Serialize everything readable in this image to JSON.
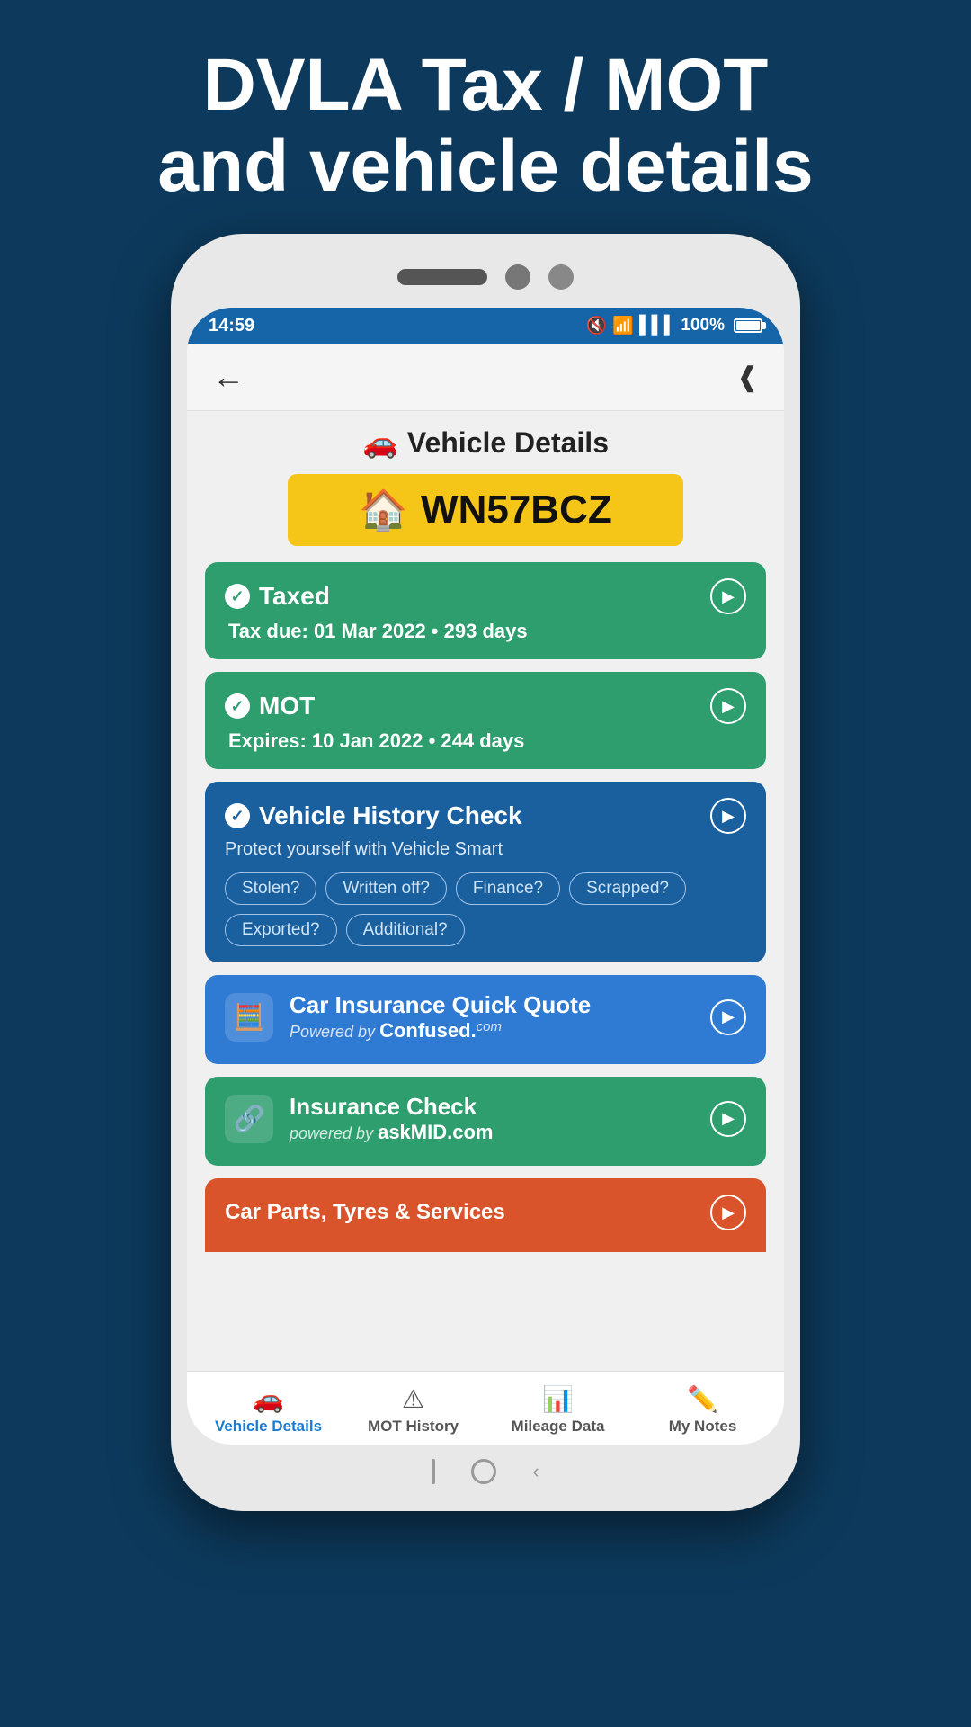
{
  "header": {
    "title_line1": "DVLA Tax / MOT",
    "title_line2": "and vehicle details"
  },
  "status_bar": {
    "time": "14:59",
    "battery": "100%"
  },
  "nav": {
    "back_label": "‹",
    "share_label": "⋘"
  },
  "page_title": "Vehicle Details",
  "license_plate": "WN57BCZ",
  "cards": {
    "taxed": {
      "title": "Taxed",
      "subtitle": "Tax due: 01 Mar 2022 • 293 days"
    },
    "mot": {
      "title": "MOT",
      "subtitle": "Expires: 10 Jan 2022 • 244 days"
    },
    "vhc": {
      "title": "Vehicle History Check",
      "desc": "Protect yourself with Vehicle Smart",
      "badges": [
        "Stolen?",
        "Written off?",
        "Finance?",
        "Scrapped?",
        "Exported?",
        "Additional?"
      ]
    },
    "insurance_quote": {
      "title": "Car Insurance Quick Quote",
      "subtitle_pre": "Powered by",
      "subtitle_brand": "Confused.",
      "subtitle_sup": "com"
    },
    "insurance_check": {
      "title": "Insurance Check",
      "subtitle_pre": "powered by",
      "subtitle_brand": "askMID.com"
    },
    "car_parts": {
      "title": "Car Parts, Tyres & Services"
    }
  },
  "bottom_nav": {
    "items": [
      {
        "label": "Vehicle Details",
        "icon": "🚗",
        "active": true
      },
      {
        "label": "MOT History",
        "icon": "⚠",
        "active": false
      },
      {
        "label": "Mileage Data",
        "icon": "📶",
        "active": false
      },
      {
        "label": "My Notes",
        "icon": "✏",
        "active": false
      }
    ]
  }
}
